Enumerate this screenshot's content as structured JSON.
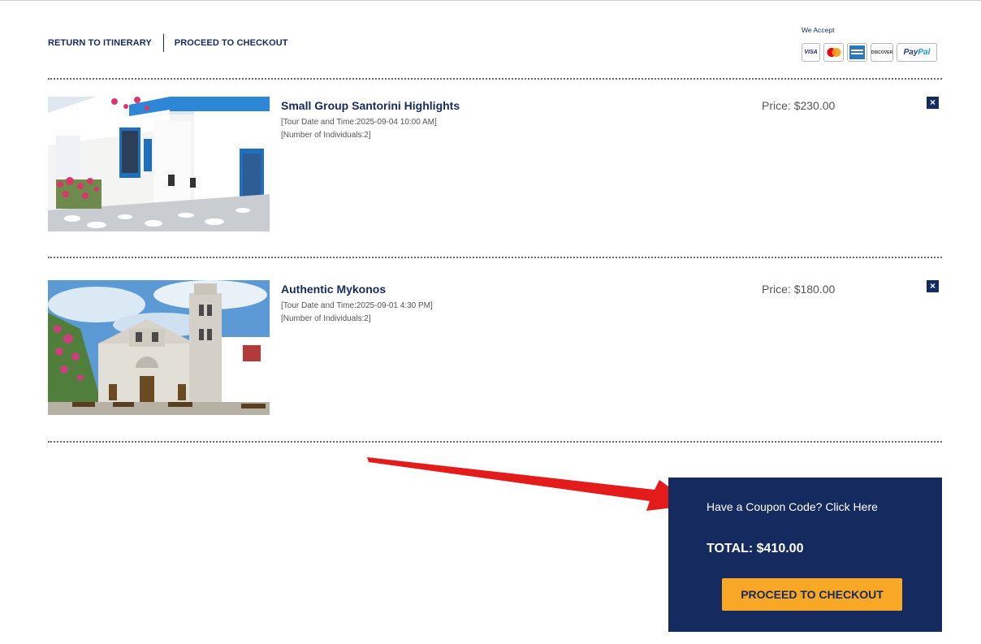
{
  "nav": {
    "return_label": "RETURN TO ITINERARY",
    "checkout_label": "PROCEED TO CHECKOUT"
  },
  "payment": {
    "label": "We Accept",
    "cards": [
      {
        "name": "visa-icon",
        "text": "VISA"
      },
      {
        "name": "mastercard-icon",
        "text": ""
      },
      {
        "name": "amex-icon",
        "text": ""
      },
      {
        "name": "discover-icon",
        "text": "DISCOVER"
      },
      {
        "name": "paypal-icon",
        "text_pay": "Pay",
        "text_pal": "Pal"
      }
    ]
  },
  "cart": {
    "items": [
      {
        "title": "Small Group Santorini Highlights",
        "date_line": "[Tour Date and Time:2025-09-04 10:00 AM]",
        "people_line": "[Number of Individuals:2]",
        "price_label": "Price:",
        "price_value": "$230.00",
        "remove_label": "×"
      },
      {
        "title": "Authentic Mykonos",
        "date_line": "[Tour Date and Time:2025-09-01 4:30 PM]",
        "people_line": "[Number of Individuals:2]",
        "price_label": "Price:",
        "price_value": "$180.00",
        "remove_label": "×"
      }
    ]
  },
  "summary": {
    "coupon_text": "Have a Coupon Code? Click Here",
    "total_label": "TOTAL:",
    "total_value": "$410.00",
    "checkout_button": "PROCEED TO CHECKOUT"
  },
  "colors": {
    "navy": "#152a5e",
    "accent": "#f9a825",
    "arrow": "#e31b1b"
  }
}
